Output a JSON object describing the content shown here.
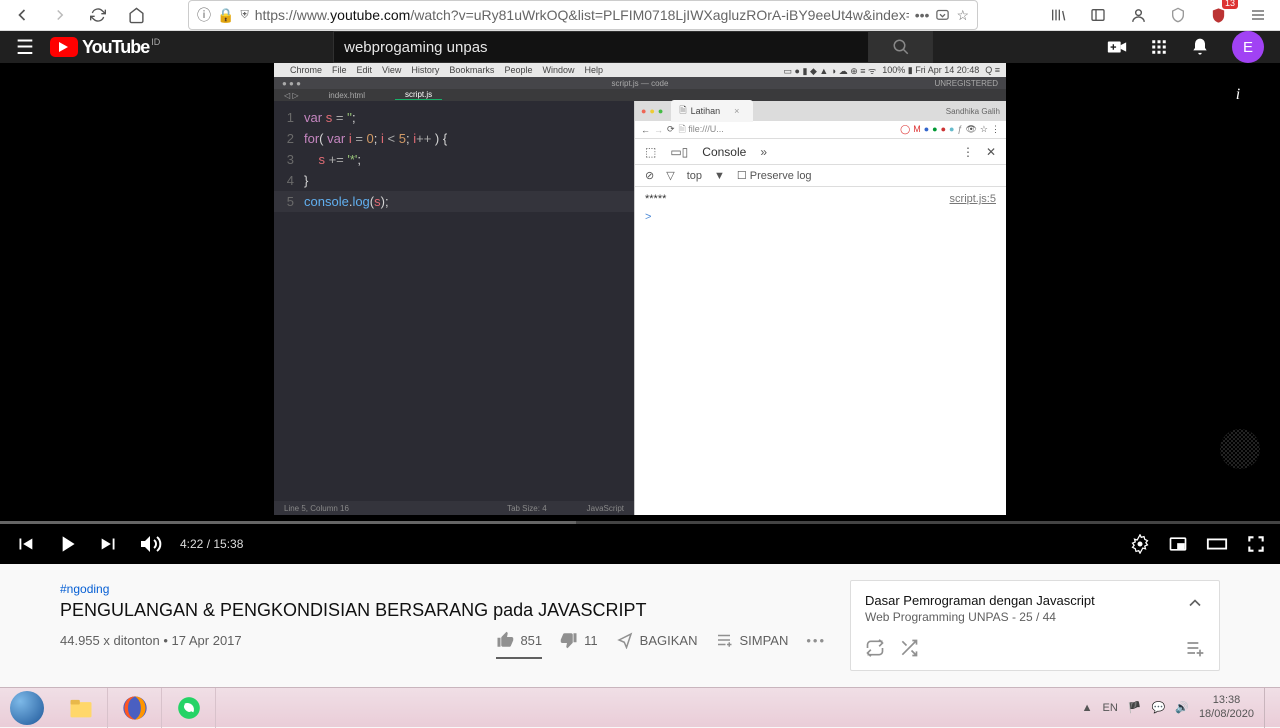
{
  "browser": {
    "url_prefix": "https://www.",
    "url_host": "youtube.com",
    "url_path": "/watch?v=uRy81uWrkOQ&list=PLFIM0718LjIWXagluzROrA-iBY9eeUt4w&index=2",
    "ublock_count": "13"
  },
  "youtube": {
    "logo_text": "YouTube",
    "logo_cc": "ID",
    "search_value": "webprogaming unpas",
    "avatar_letter": "E"
  },
  "video_content": {
    "mac_menu": [
      "Chrome",
      "File",
      "Edit",
      "View",
      "History",
      "Bookmarks",
      "People",
      "Window",
      "Help"
    ],
    "mac_status": "100% ▮  Fri Apr 14  20:48",
    "tabs": {
      "left": "index.html",
      "active": "script.js",
      "header": "script.js — code",
      "status": "UNREGISTERED"
    },
    "code": [
      "var s = '';",
      "for( var i = 0; i < 5; i++ ) {",
      "    s += '*';",
      "}",
      "console.log(s);"
    ],
    "editor_status": {
      "left": "Line 5, Column 16",
      "tab": "Tab Size: 4",
      "lang": "JavaScript"
    },
    "chrome": {
      "tab_title": "Latihan",
      "user": "Sandhika Galih",
      "url": "file:///U..."
    },
    "devtools": {
      "panel": "Console",
      "filter_scope": "top",
      "preserve": "Preserve log"
    },
    "console": {
      "output": "*****",
      "source": "script.js:5",
      "prompt": ">"
    }
  },
  "player": {
    "current": "4:22",
    "duration": "15:38",
    "played_pct": 28.4
  },
  "meta": {
    "hashtag": "#ngoding",
    "title": "PENGULANGAN & PENGKONDISIAN BERSARANG pada JAVASCRIPT",
    "views_date": "44.955 x ditonton • 17 Apr 2017",
    "likes": "851",
    "dislikes": "11",
    "share": "BAGIKAN",
    "save": "SIMPAN"
  },
  "playlist": {
    "title": "Dasar Pemrograman dengan Javascript",
    "channel": "Web Programming UNPAS",
    "position": "25 / 44"
  },
  "taskbar": {
    "lang": "EN",
    "time": "13:38",
    "date": "18/08/2020"
  }
}
